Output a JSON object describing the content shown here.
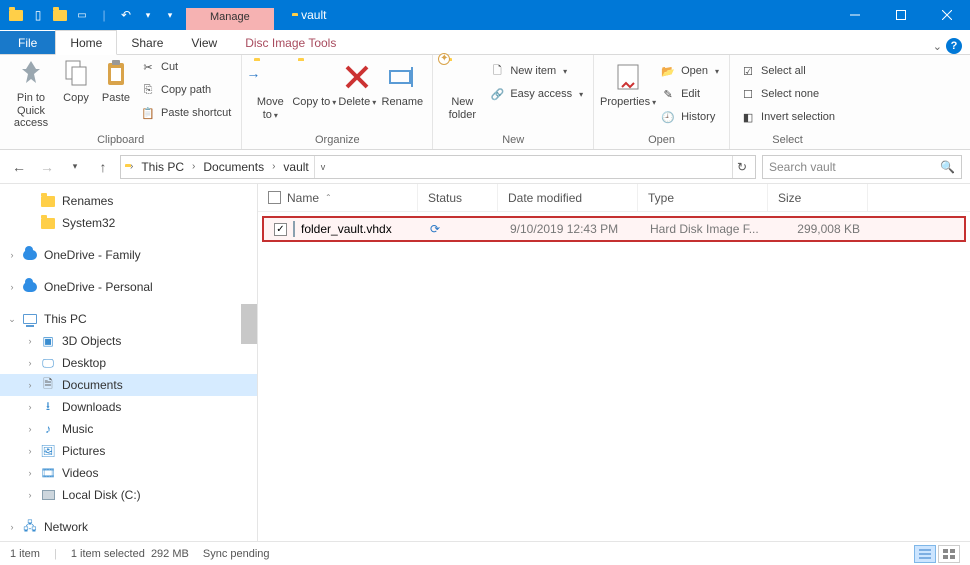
{
  "titlebar": {
    "contextual_label": "Manage",
    "title": "vault"
  },
  "tabs": {
    "file": "File",
    "home": "Home",
    "share": "Share",
    "view": "View",
    "context": "Disc Image Tools"
  },
  "ribbon": {
    "clipboard": {
      "label": "Clipboard",
      "pin": "Pin to Quick access",
      "copy": "Copy",
      "paste": "Paste",
      "cut": "Cut",
      "copy_path": "Copy path",
      "paste_shortcut": "Paste shortcut"
    },
    "organize": {
      "label": "Organize",
      "move_to": "Move to",
      "copy_to": "Copy to",
      "delete": "Delete",
      "rename": "Rename"
    },
    "new": {
      "label": "New",
      "new_folder": "New folder",
      "new_item": "New item",
      "easy_access": "Easy access"
    },
    "open": {
      "label": "Open",
      "properties": "Properties",
      "open": "Open",
      "edit": "Edit",
      "history": "History"
    },
    "select": {
      "label": "Select",
      "select_all": "Select all",
      "select_none": "Select none",
      "invert": "Invert selection"
    }
  },
  "nav": {
    "breadcrumb": [
      "This PC",
      "Documents",
      "vault"
    ],
    "search_placeholder": "Search vault"
  },
  "columns": {
    "name": "Name",
    "status": "Status",
    "date": "Date modified",
    "type": "Type",
    "size": "Size"
  },
  "tree": {
    "renames": "Renames",
    "system32": "System32",
    "onedrive_family": "OneDrive - Family",
    "onedrive_personal": "OneDrive - Personal",
    "this_pc": "This PC",
    "objects3d": "3D Objects",
    "desktop": "Desktop",
    "documents": "Documents",
    "downloads": "Downloads",
    "music": "Music",
    "pictures": "Pictures",
    "videos": "Videos",
    "local_disk": "Local Disk (C:)",
    "network": "Network"
  },
  "files": [
    {
      "name": "folder_vault.vhdx",
      "status_icon": "sync",
      "date": "9/10/2019 12:43 PM",
      "type": "Hard Disk Image F...",
      "size": "299,008 KB",
      "checked": true
    }
  ],
  "status": {
    "count": "1 item",
    "selected": "1 item selected",
    "size": "292 MB",
    "sync": "Sync pending"
  }
}
